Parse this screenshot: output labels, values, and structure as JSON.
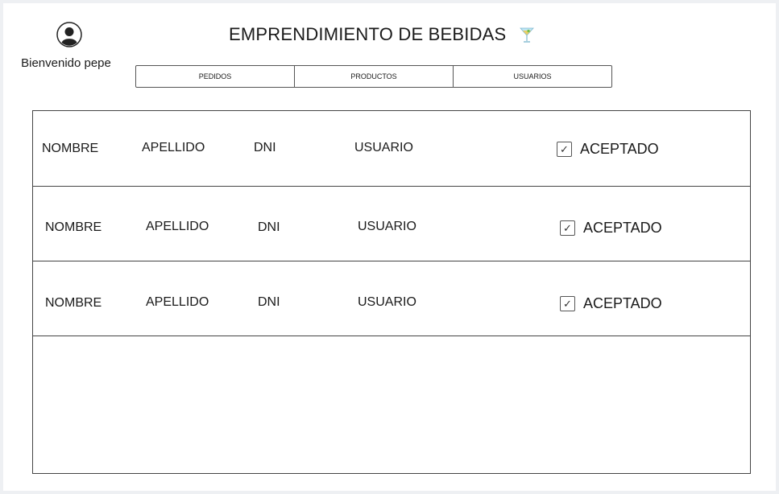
{
  "header": {
    "welcome_text": "Bienvenido pepe",
    "title": "EMPRENDIMIENTO DE BEBIDAS",
    "avatar_icon": "user-avatar-icon",
    "title_icon": "cocktail-icon"
  },
  "tabs": [
    {
      "label": "PEDIDOS"
    },
    {
      "label": "PRODUCTOS"
    },
    {
      "label": "USUARIOS"
    }
  ],
  "rows": [
    {
      "nombre": "NOMBRE",
      "apellido": "APELLIDO",
      "dni": "DNI",
      "usuario": "USUARIO",
      "checked": true,
      "status": "ACEPTADO"
    },
    {
      "nombre": "NOMBRE",
      "apellido": "APELLIDO",
      "dni": "DNI",
      "usuario": "USUARIO",
      "checked": true,
      "status": "ACEPTADO"
    },
    {
      "nombre": "NOMBRE",
      "apellido": "APELLIDO",
      "dni": "DNI",
      "usuario": "USUARIO",
      "checked": true,
      "status": "ACEPTADO"
    }
  ],
  "colors": {
    "page_background": "#eef0f3",
    "canvas": "#ffffff",
    "border": "#444444"
  }
}
